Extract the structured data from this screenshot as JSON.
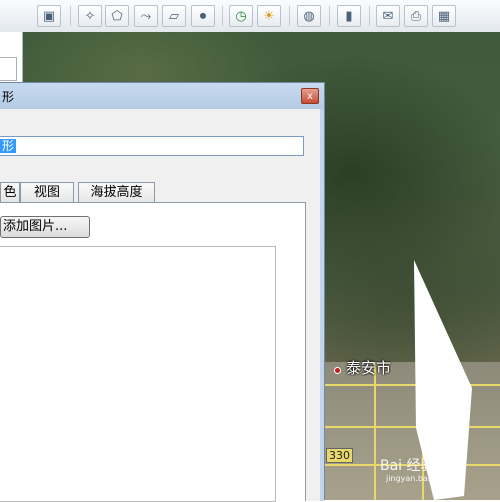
{
  "toolbar": {
    "buttons": [
      {
        "icon": "sidebar-toggle-icon",
        "glyph": "▣"
      },
      {
        "icon": "add-placemark-icon",
        "glyph": "✧"
      },
      {
        "icon": "add-polygon-icon",
        "glyph": "⬠"
      },
      {
        "icon": "add-path-icon",
        "glyph": "⤳"
      },
      {
        "icon": "add-image-overlay-icon",
        "glyph": "▱"
      },
      {
        "icon": "record-tour-icon",
        "glyph": "⏺"
      },
      {
        "icon": "historical-imagery-icon",
        "glyph": "◷"
      },
      {
        "icon": "sunlight-icon",
        "glyph": "☀"
      },
      {
        "icon": "planets-icon",
        "glyph": "◍"
      },
      {
        "icon": "ruler-icon",
        "glyph": "▮"
      },
      {
        "icon": "email-icon",
        "glyph": "✉"
      },
      {
        "icon": "print-icon",
        "glyph": "⎙"
      },
      {
        "icon": "save-image-icon",
        "glyph": "▦"
      }
    ]
  },
  "dialog": {
    "title": "形",
    "name_value": "形",
    "close_label": "x",
    "tabs": [
      "色",
      "视图",
      "海拔高度"
    ],
    "add_image_label": "添加图片..."
  },
  "map": {
    "city_label": "泰安市",
    "road_label": "330",
    "watermark": "Bai 经验",
    "watermark_sub": "jingyan.baidu.com"
  }
}
